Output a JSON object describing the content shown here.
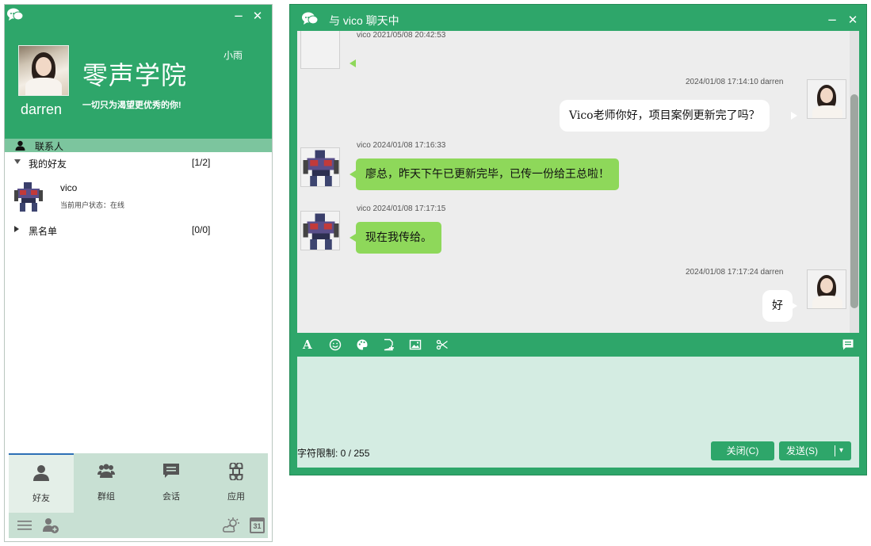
{
  "main_panel": {
    "user_name": "darren",
    "school_name": "零声学院",
    "slogan": "一切只为渴望更优秀的你!",
    "nickname": "小雨",
    "minimize_label": "−",
    "close_label": "✕",
    "contacts_label": "联系人",
    "groups": [
      {
        "name": "我的好友",
        "count": "[1/2]",
        "expanded": true
      },
      {
        "name": "黑名单",
        "count": "[0/0]",
        "expanded": false
      }
    ],
    "friend": {
      "name": "vico",
      "status": "当前用户状态：在线"
    },
    "tabs": [
      {
        "label": "好友",
        "icon": "person-icon",
        "active": true
      },
      {
        "label": "群组",
        "icon": "group-icon",
        "active": false
      },
      {
        "label": "会话",
        "icon": "chat-icon",
        "active": false
      },
      {
        "label": "应用",
        "icon": "command-icon",
        "active": false
      }
    ],
    "calendar_day": "31"
  },
  "chat": {
    "title": "与 vico 聊天中",
    "minimize_label": "−",
    "close_label": "✕",
    "messages": [
      {
        "direction": "in",
        "meta": "vico 2021/05/08 20:42:53",
        "text": ""
      },
      {
        "direction": "out",
        "meta": "2024/01/08 17:14:10  darren",
        "text": "Vico老师你好，项目案例更新完了吗？"
      },
      {
        "direction": "in",
        "meta": "vico 2024/01/08 17:16:33",
        "text": "廖总，昨天下午已更新完毕，已传一份给王总啦！"
      },
      {
        "direction": "in",
        "meta": "vico 2024/01/08 17:17:15",
        "text": "现在我传给。"
      },
      {
        "direction": "out",
        "meta": "2024/01/08 17:17:24  darren",
        "text": "好"
      }
    ],
    "char_limit": "字符限制: 0 / 255",
    "close_button": "关闭(C)",
    "send_button": "发送(S)",
    "send_dropdown": "▾",
    "colors": {
      "accent": "#2ea66a",
      "incoming_bubble": "#8ed85a",
      "input_bg": "#d4ece2"
    }
  }
}
